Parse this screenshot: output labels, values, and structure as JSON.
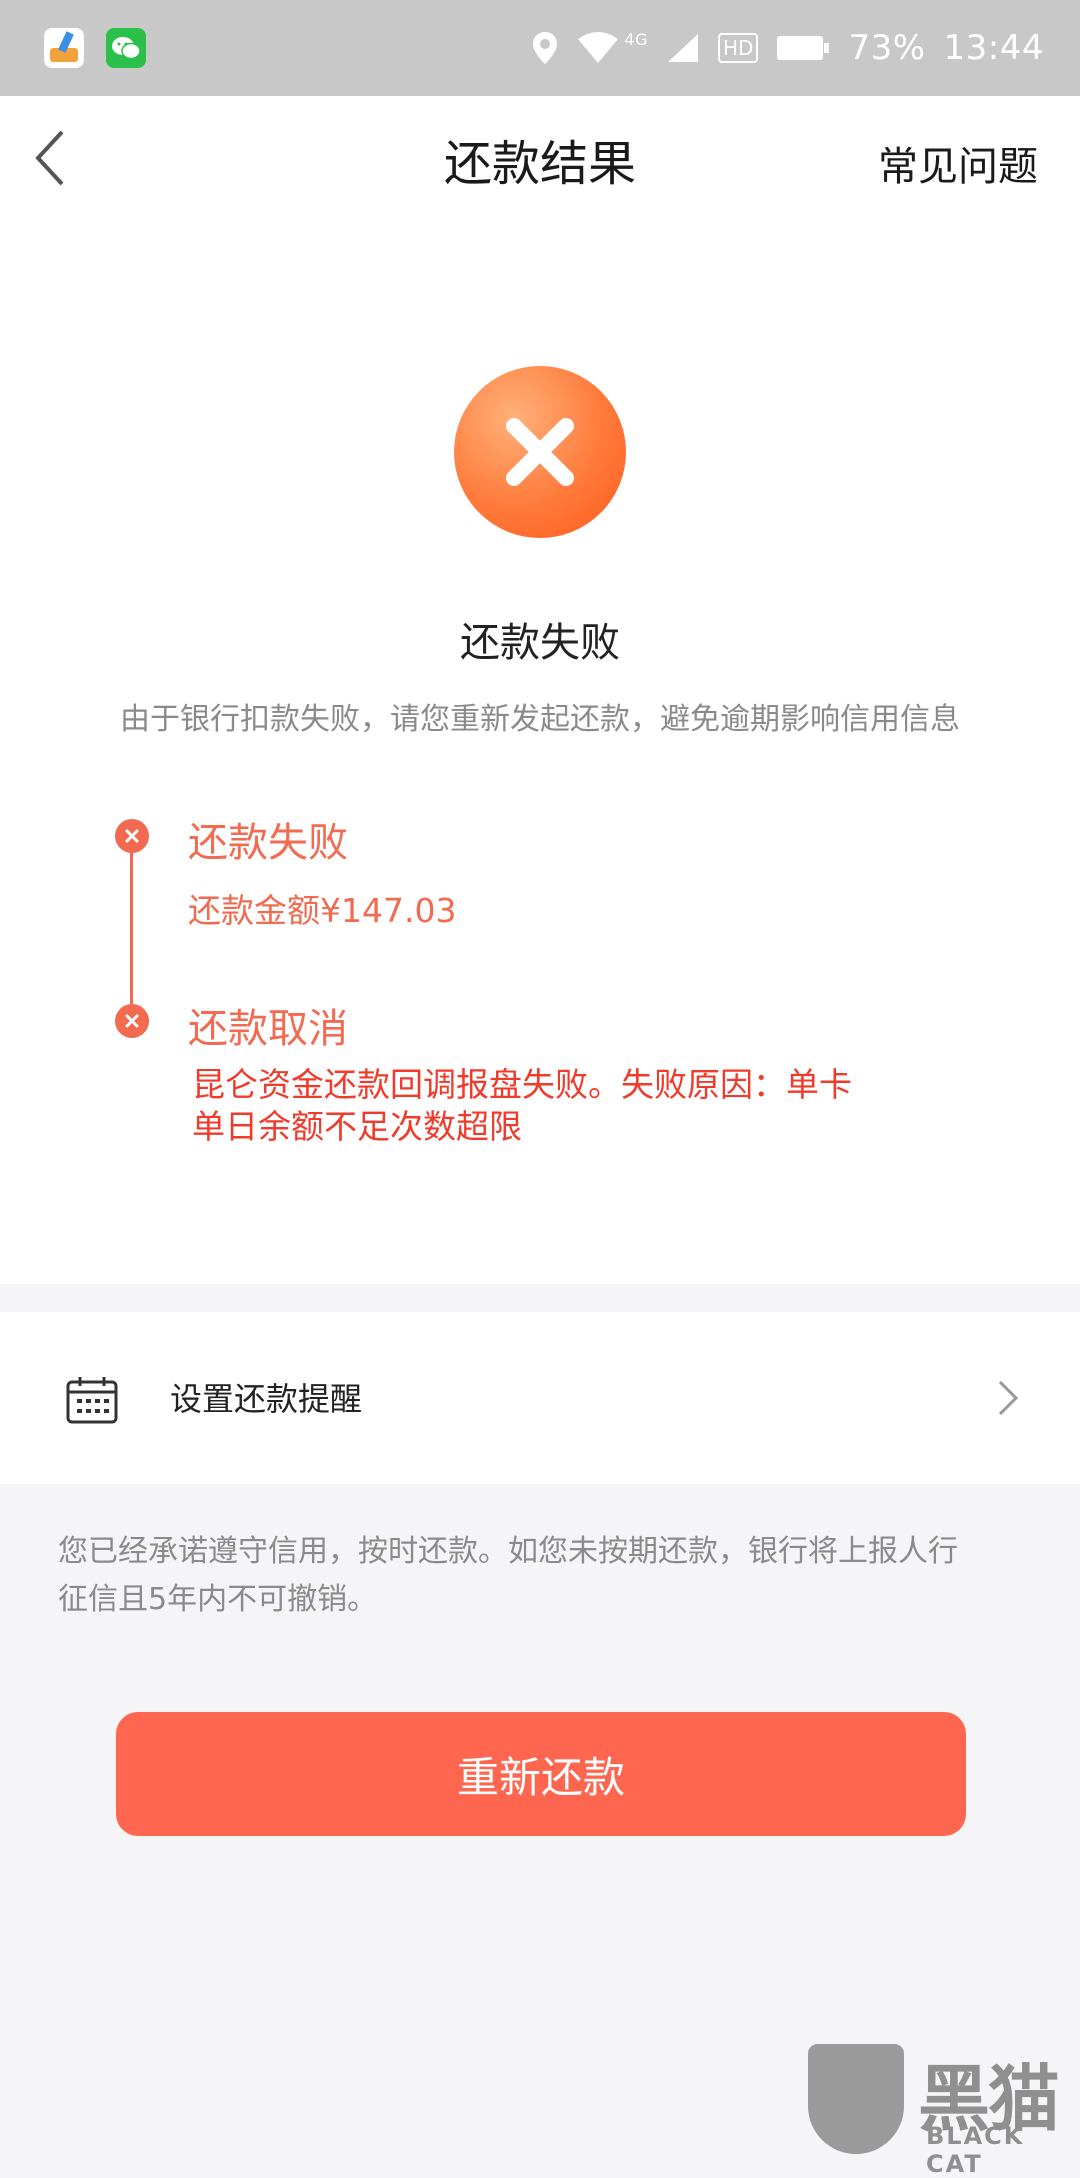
{
  "status_bar": {
    "network": "4G",
    "hd": "HD",
    "battery": "73%",
    "time": "13:44"
  },
  "header": {
    "title": "还款结果",
    "faq": "常见问题"
  },
  "result": {
    "title": "还款失败",
    "description": "由于银行扣款失败，请您重新发起还款，避免逾期影响信用信息"
  },
  "timeline": {
    "step1_title": "还款失败",
    "step1_amount": "还款金额¥147.03",
    "step2_title": "还款取消",
    "step2_reason_line1": "昆仑资金还款回调报盘失败。失败原因：单卡",
    "step2_reason_line2": "单日余额不足次数超限"
  },
  "reminder": {
    "label": "设置还款提醒"
  },
  "notice": {
    "line1": "您已经承诺遵守信用，按时还款。如您未按期还款，银行将上报人行",
    "line2": "征信且5年内不可撤销。"
  },
  "actions": {
    "retry_label": "重新还款"
  },
  "watermark": {
    "cn": "黑猫",
    "en": "BLACK CAT"
  },
  "colors": {
    "accent": "#ff6650",
    "error_text": "#f26a4f"
  }
}
